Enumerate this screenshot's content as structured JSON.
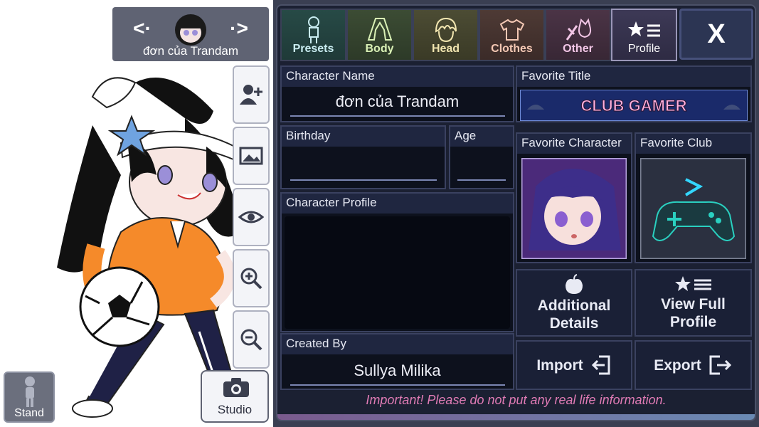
{
  "character_selector": {
    "name": "đơn của Trandam",
    "prev_icon": "chevron-left-icon",
    "next_icon": "chevron-right-icon"
  },
  "stage_tools": [
    {
      "name": "add-character-button",
      "icon": "add-person-icon"
    },
    {
      "name": "background-button",
      "icon": "image-icon"
    },
    {
      "name": "view-button",
      "icon": "eye-icon"
    },
    {
      "name": "zoom-in-button",
      "icon": "zoom-in-icon"
    },
    {
      "name": "zoom-out-button",
      "icon": "zoom-out-icon"
    }
  ],
  "stand_label": "Stand",
  "studio_label": "Studio",
  "tabs": [
    {
      "label": "Presets"
    },
    {
      "label": "Body"
    },
    {
      "label": "Head"
    },
    {
      "label": "Clothes"
    },
    {
      "label": "Other"
    },
    {
      "label": "Profile"
    }
  ],
  "close_label": "X",
  "profile": {
    "character_name_label": "Character Name",
    "character_name_value": "đơn của Trandam",
    "favorite_title_label": "Favorite Title",
    "favorite_title_value": "CLUB GAMER",
    "birthday_label": "Birthday",
    "birthday_value": "",
    "age_label": "Age",
    "age_value": "",
    "favorite_character_label": "Favorite Character",
    "favorite_club_label": "Favorite Club",
    "character_profile_label": "Character Profile",
    "character_profile_value": "",
    "created_by_label": "Created By",
    "created_by_value": "Sullya Milika",
    "additional_details_line1": "Additional",
    "additional_details_line2": "Details",
    "view_full_line1": "View Full",
    "view_full_line2": "Profile",
    "import_label": "Import",
    "export_label": "Export"
  },
  "notice": "Important! Please do not put any real life information.",
  "colors": {
    "panel_bg": "#1b2032",
    "notice": "#e07bb5",
    "title_banner": "#ffb0e0"
  }
}
